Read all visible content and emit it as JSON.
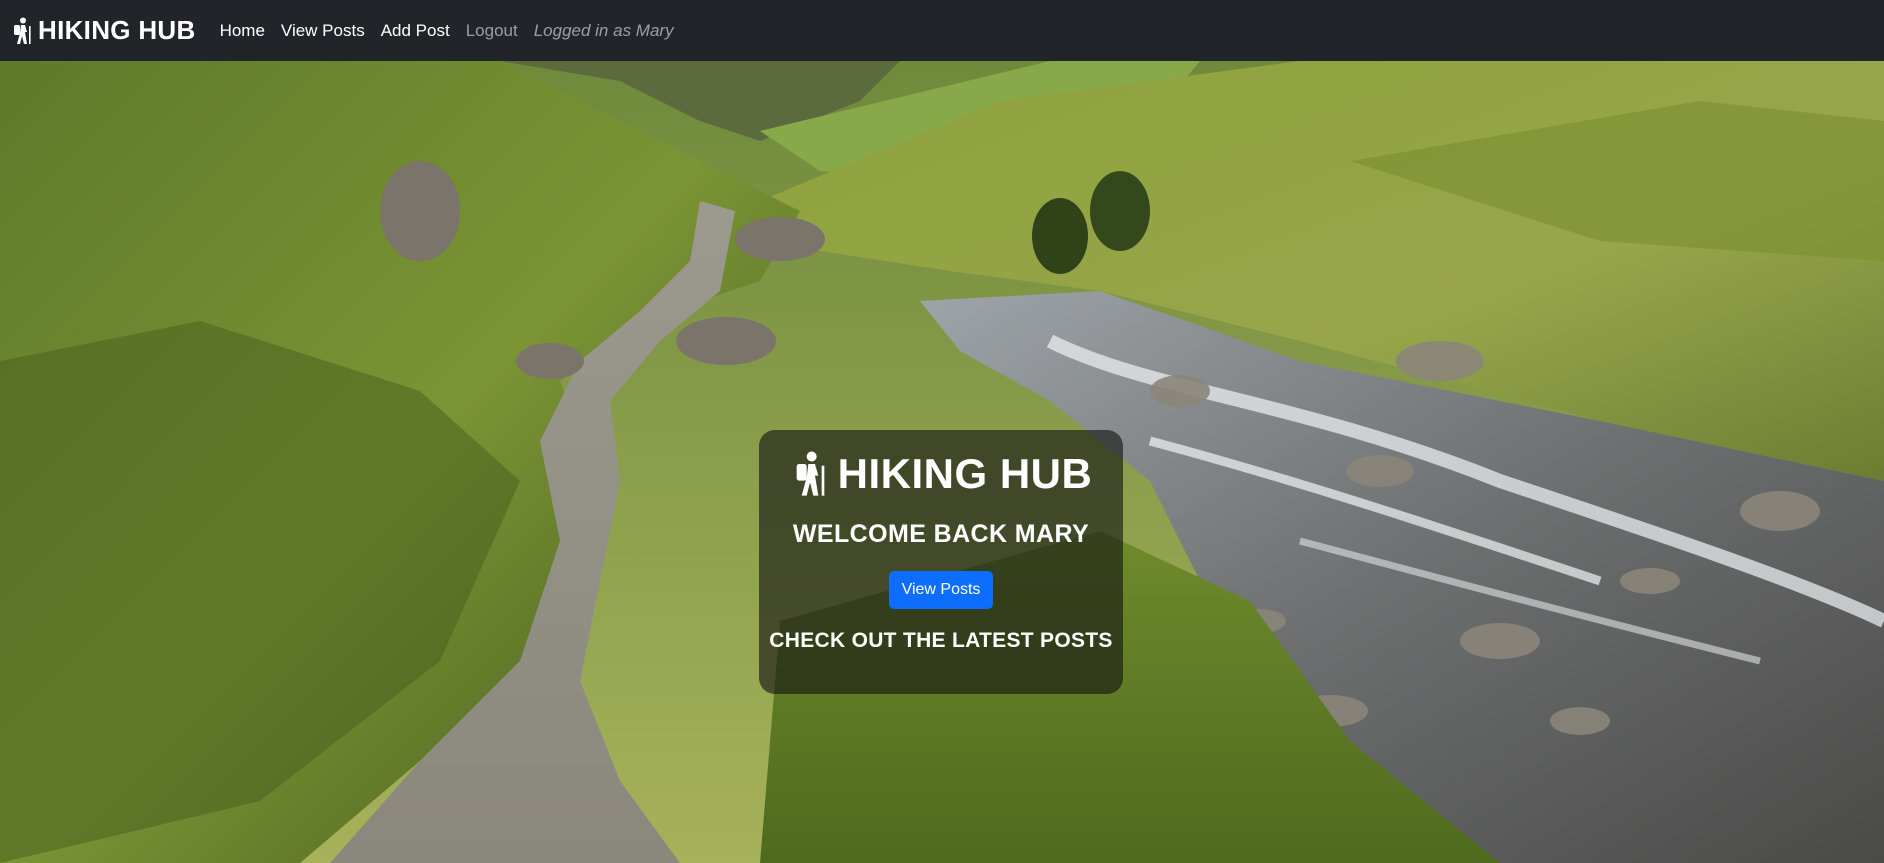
{
  "navbar": {
    "brand_icon": "hiker-icon",
    "brand": "HIKING HUB",
    "links": {
      "home": "Home",
      "view_posts": "View Posts",
      "add_post": "Add Post",
      "logout": "Logout"
    },
    "status": "Logged in as Mary"
  },
  "hero": {
    "background": "mountain valley with footpath and stream",
    "icon": "hiker-icon",
    "title": "HIKING HUB",
    "welcome": "WELCOME BACK MARY",
    "button_label": "View Posts",
    "tagline": "CHECK OUT THE LATEST POSTS"
  },
  "colors": {
    "navbar_bg": "#212529",
    "button_primary": "#0d6efd",
    "text_light": "#ffffff"
  }
}
